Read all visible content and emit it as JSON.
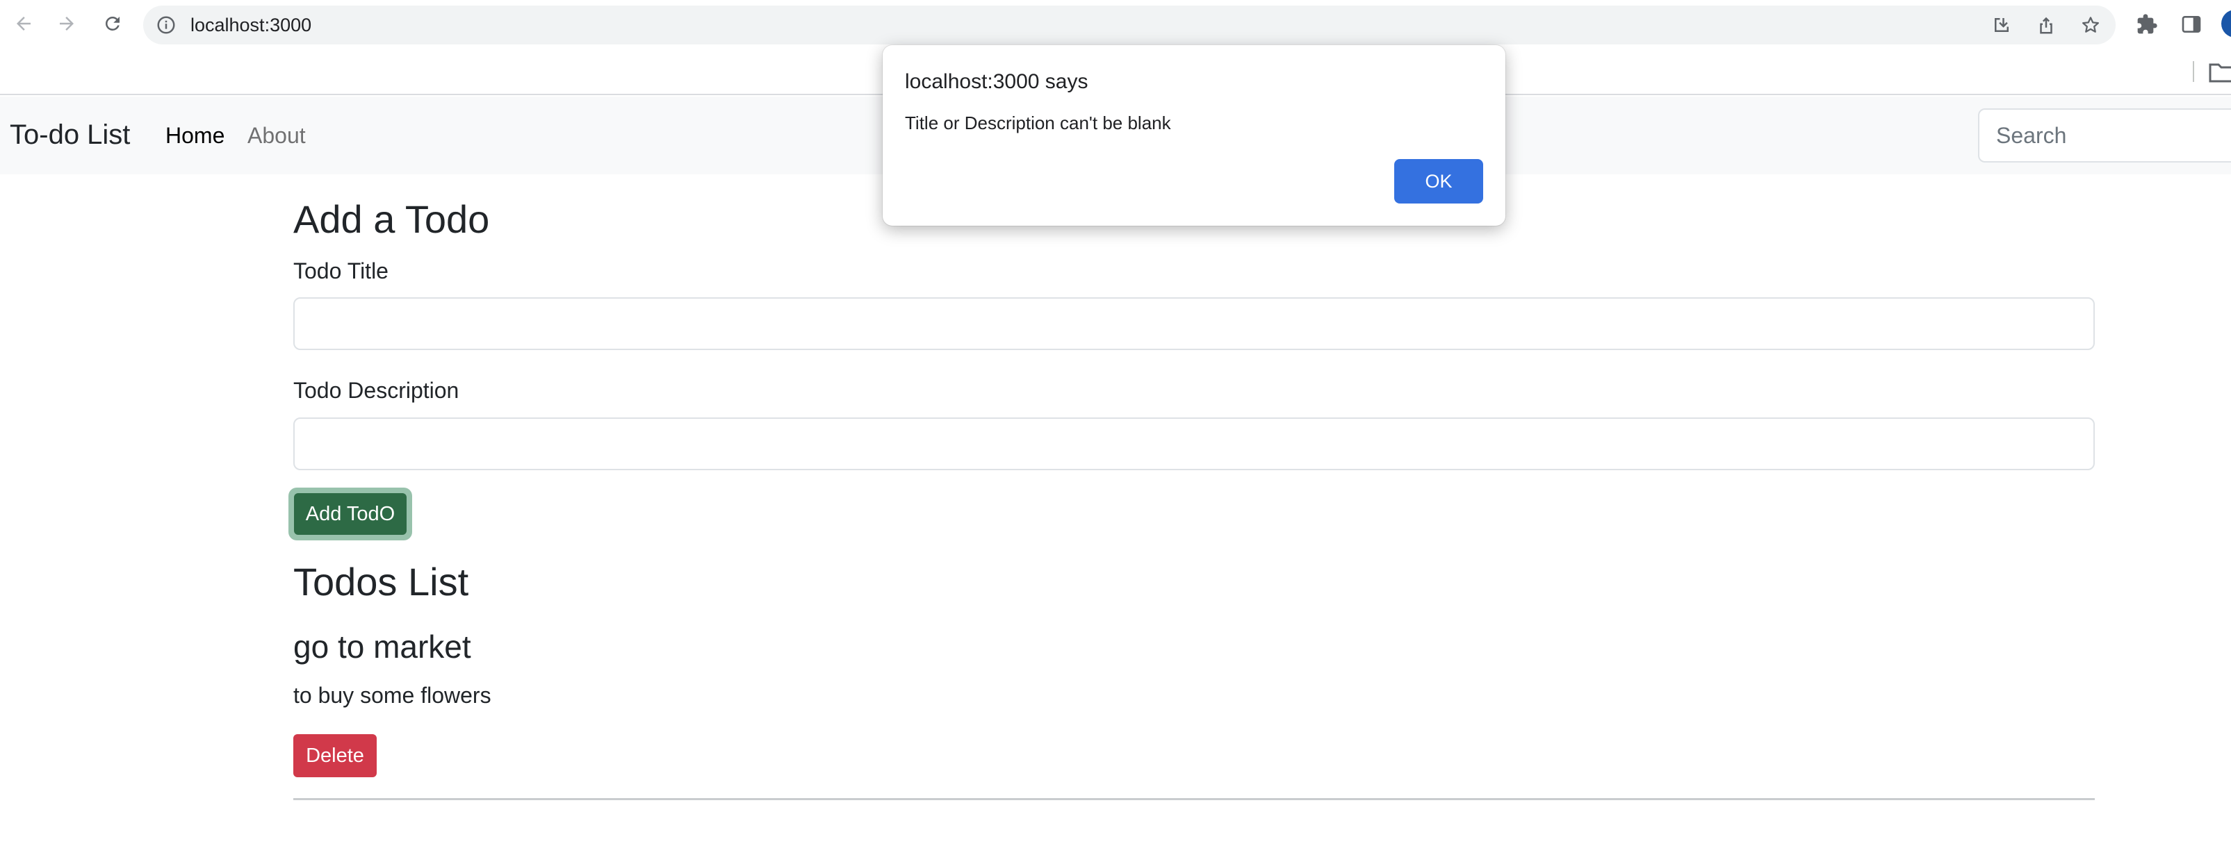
{
  "browser": {
    "url": "localhost:3000",
    "icons": [
      "back-arrow-icon",
      "forward-arrow-icon",
      "reload-icon",
      "info-icon",
      "download-icon",
      "share-icon",
      "star-icon",
      "extensions-puzzle-icon",
      "side-panel-icon",
      "folder-icon"
    ]
  },
  "navbar": {
    "brand": "To-do List",
    "links": [
      {
        "label": "Home",
        "active": true
      },
      {
        "label": "About",
        "active": false
      }
    ],
    "search_placeholder": "Search"
  },
  "form": {
    "heading": "Add a Todo",
    "title_label": "Todo Title",
    "title_value": "",
    "description_label": "Todo Description",
    "description_value": "",
    "submit_label": "Add TodO"
  },
  "todos": {
    "heading": "Todos List",
    "items": [
      {
        "title": "go to market",
        "description": "to buy some flowers",
        "delete_label": "Delete"
      }
    ]
  },
  "dialog": {
    "title": "localhost:3000 says",
    "message": "Title or Description can't be blank",
    "ok_label": "OK"
  },
  "colors": {
    "navbar_bg": "#f8f9fa",
    "add_button": "#2d6a45",
    "delete_button": "#d1394a",
    "dialog_ok": "#3471e0"
  }
}
